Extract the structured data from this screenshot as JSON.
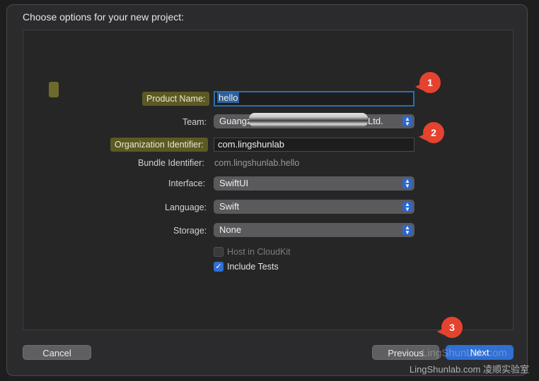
{
  "dialog": {
    "title": "Choose options for your new project:"
  },
  "form": {
    "product_name": {
      "label": "Product Name:",
      "value": "hello"
    },
    "team": {
      "label": "Team:",
      "value_start": "Guangz.",
      "value_end": "Ltd."
    },
    "organization_identifier": {
      "label": "Organization Identifier:",
      "value": "com.lingshunlab"
    },
    "bundle_identifier": {
      "label": "Bundle Identifier:",
      "value": "com.lingshunlab.hello"
    },
    "interface": {
      "label": "Interface:",
      "value": "SwiftUI"
    },
    "language": {
      "label": "Language:",
      "value": "Swift"
    },
    "storage": {
      "label": "Storage:",
      "value": "None"
    },
    "host_in_cloudkit": {
      "label": "Host in CloudKit",
      "checked": false,
      "enabled": false
    },
    "include_tests": {
      "label": "Include Tests",
      "checked": true
    }
  },
  "annotations": [
    "1",
    "2",
    "3"
  ],
  "buttons": {
    "cancel": "Cancel",
    "previous": "Previous",
    "next": "Next"
  },
  "watermark": {
    "overlay": "LingShunLab.com",
    "footer": "LingShunlab.com 凌顺实验室"
  },
  "colors": {
    "accent": "#2f6fd6",
    "highlight": "#5c5a24",
    "annotation": "#e4432f"
  }
}
